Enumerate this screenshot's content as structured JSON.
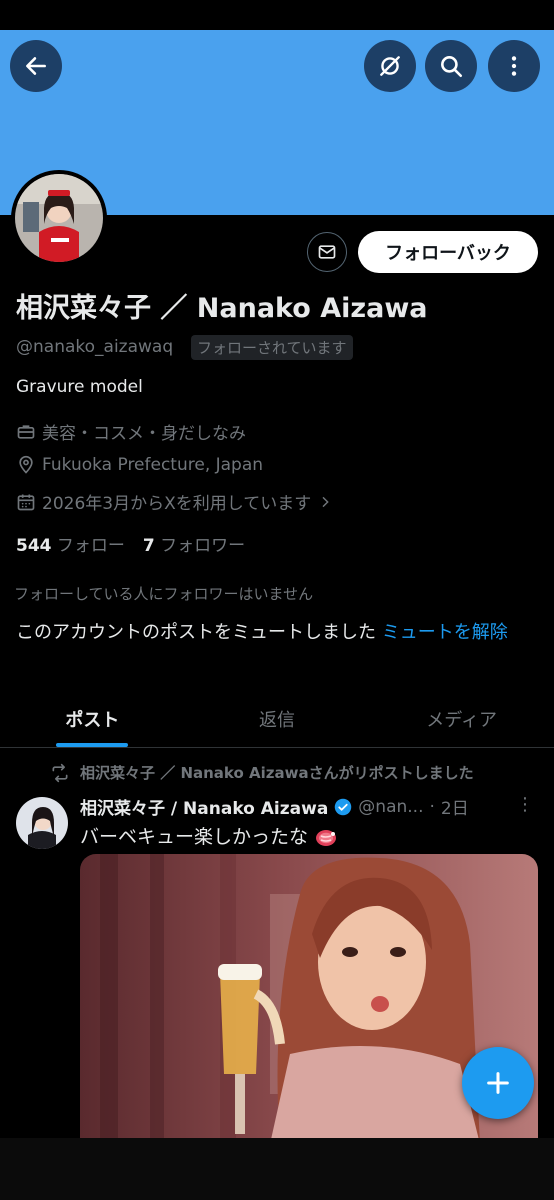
{
  "header": {
    "back_icon": "arrow-left-icon",
    "grok_icon": "grok-icon",
    "search_icon": "search-icon",
    "more_icon": "more-vertical-icon",
    "banner_color": "#4aa1ee"
  },
  "profile": {
    "display_name": "相沢菜々子 ／ Nanako Aizawa",
    "handle": "@nanako_aizawaq",
    "follows_you": "フォローされています",
    "bio": "Gravure model",
    "category": "美容・コスメ・身だしなみ",
    "location": "Fukuoka Prefecture, Japan",
    "joined": "2026年3月からXを利用しています",
    "following_count": "544",
    "following_label": "フォロー",
    "followers_count": "7",
    "followers_label": "フォロワー",
    "follow_back_label": "フォローバック"
  },
  "notices": {
    "no_mutual": "フォローしている人にフォロワーはいません",
    "muted_text": "このアカウントのポストをミュートしました",
    "unmute_link": "ミュートを解除"
  },
  "tabs": [
    {
      "label": "ポスト",
      "active": true
    },
    {
      "label": "返信",
      "active": false
    },
    {
      "label": "メディア",
      "active": false
    }
  ],
  "post": {
    "repost_text": "相沢菜々子 ／ Nanako Aizawaさんがリポストしました",
    "author": "相沢菜々子 / Nanako Aizawa",
    "handle": "@nan...",
    "time": "2日",
    "text": "バーベキュー楽しかったな",
    "verified_color": "#1d9bf0"
  },
  "fab": {
    "icon": "plus-icon"
  }
}
